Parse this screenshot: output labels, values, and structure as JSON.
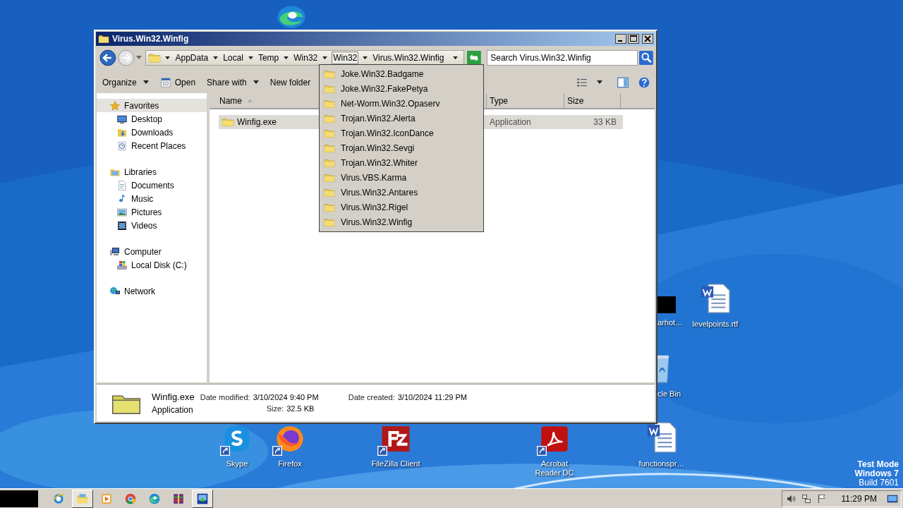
{
  "window": {
    "title": "Virus.Win32.Winfig"
  },
  "address": {
    "crumbs": [
      {
        "label": "AppData",
        "selected": false
      },
      {
        "label": "Local",
        "selected": false
      },
      {
        "label": "Temp",
        "selected": false
      },
      {
        "label": "Win32",
        "selected": false
      },
      {
        "label": "Win32",
        "selected": true
      },
      {
        "label": "Virus.Win32.Winfig",
        "selected": false
      }
    ]
  },
  "search": {
    "placeholder": "Search Virus.Win32.Winfig"
  },
  "toolbar": [
    {
      "label": "Organize",
      "kind": "menu"
    },
    {
      "label": "Open",
      "kind": "open"
    },
    {
      "label": "Share with",
      "kind": "menu"
    },
    {
      "label": "New folder",
      "kind": "plain"
    }
  ],
  "sidebar": [
    {
      "label": "Favorites",
      "kind": "star",
      "selected": true,
      "children": [
        {
          "label": "Desktop",
          "kind": "desktop",
          "selected": false
        },
        {
          "label": "Downloads",
          "kind": "downloads",
          "selected": false
        },
        {
          "label": "Recent Places",
          "kind": "recent",
          "selected": false
        }
      ]
    },
    {
      "label": "Libraries",
      "kind": "libraries",
      "selected": false,
      "children": [
        {
          "label": "Documents",
          "kind": "documents",
          "selected": false
        },
        {
          "label": "Music",
          "kind": "music",
          "selected": false
        },
        {
          "label": "Pictures",
          "kind": "pictures",
          "selected": false
        },
        {
          "label": "Videos",
          "kind": "videos",
          "selected": false
        }
      ]
    },
    {
      "label": "Computer",
      "kind": "computer",
      "selected": false,
      "children": [
        {
          "label": "Local Disk (C:)",
          "kind": "disk",
          "selected": false
        }
      ]
    },
    {
      "label": "Network",
      "kind": "network",
      "selected": false
    }
  ],
  "columns": [
    {
      "label": "Name",
      "sorted": true
    },
    {
      "label": "Type",
      "sorted": false
    },
    {
      "label": "Size",
      "sorted": false
    }
  ],
  "rows": [
    {
      "name": "Winfig.exe",
      "type": "Application",
      "size": "33 KB",
      "selected": true
    }
  ],
  "dropdown": {
    "items": [
      "Joke.Win32.Badgame",
      "Joke.Win32.FakePetya",
      "Net-Worm.Win32.Opaserv",
      "Trojan.Win32.Alerta",
      "Trojan.Win32.IconDance",
      "Trojan.Win32.Sevgi",
      "Trojan.Win32.Whiter",
      "Virus.VBS.Karma",
      "Virus.Win32.Antares",
      "Virus.Win32.Rigel",
      "Virus.Win32.Winfig"
    ]
  },
  "details": {
    "name": "Winfig.exe",
    "type": "Application",
    "fields": [
      {
        "label": "Date modified:",
        "value": "3/10/2024 9:40 PM"
      },
      {
        "label": "Date created:",
        "value": "3/10/2024 11:29 PM"
      },
      {
        "label": "Size:",
        "value": "32.5 KB"
      }
    ]
  },
  "desktop_icons": [
    {
      "kind": "edge"
    },
    {
      "kind": "black",
      "label": "arhot…"
    },
    {
      "kind": "word",
      "label": "levelpoints.rtf"
    },
    {
      "kind": "recycle",
      "label": "cle Bin"
    },
    {
      "kind": "skype",
      "label": "Skype"
    },
    {
      "kind": "firefox",
      "label": "Firefox"
    },
    {
      "kind": "filezilla",
      "label": "FileZilla Client"
    },
    {
      "kind": "acrobat",
      "label": "Acrobat Reader DC"
    },
    {
      "kind": "word",
      "label": "functionspr…"
    }
  ],
  "test_mode": [
    {
      "text": "Test Mode",
      "bold": true
    },
    {
      "text": "Windows 7",
      "bold": true
    },
    {
      "text": "Build 7601",
      "bold": false
    }
  ],
  "taskbar": {
    "apps": [
      {
        "kind": "ie",
        "selected": false
      },
      {
        "kind": "explorer",
        "selected": true
      },
      {
        "kind": "media",
        "selected": false
      },
      {
        "kind": "chrome",
        "selected": false
      },
      {
        "kind": "edge",
        "selected": false
      },
      {
        "kind": "winrar",
        "selected": false
      },
      {
        "kind": "app",
        "selected": true
      }
    ],
    "clock": "11:29 PM"
  }
}
